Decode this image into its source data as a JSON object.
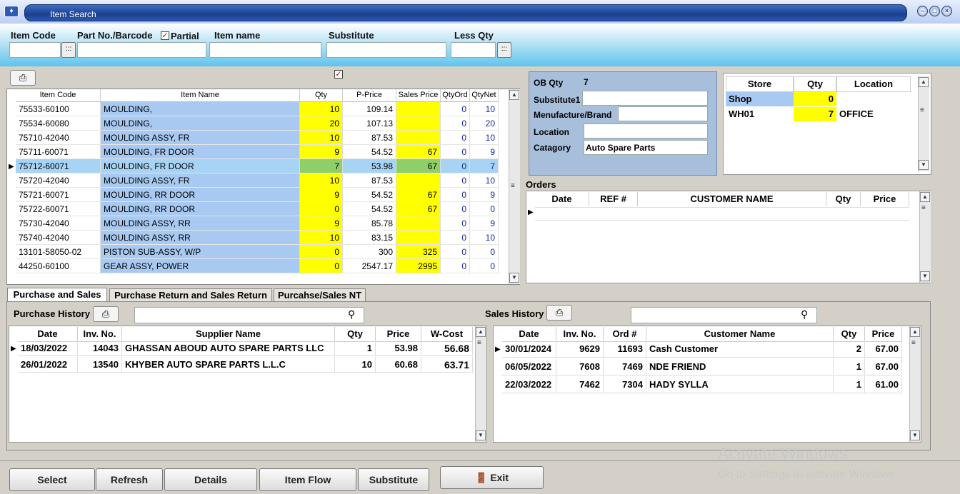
{
  "window": {
    "title": "Item Search"
  },
  "search": {
    "item_code_label": "Item Code",
    "partno_label": "Part No./Barcode",
    "partial_label": "Partial",
    "itemname_label": "Item name",
    "substitute_label": "Substitute",
    "lessqty_label": "Less Qty"
  },
  "items_grid": {
    "headers": [
      "Item Code",
      "Item Name",
      "Qty",
      "P-Price",
      "Sales Price",
      "QtyOrd",
      "QtyNet"
    ],
    "rows": [
      {
        "code": "75533-60100",
        "name": "MOULDING,",
        "qty": "10",
        "pprice": "109.14",
        "sprice": "",
        "ord": "0",
        "net": "10"
      },
      {
        "code": "75534-60080",
        "name": "MOULDING,",
        "qty": "20",
        "pprice": "107.13",
        "sprice": "",
        "ord": "0",
        "net": "20"
      },
      {
        "code": "75710-42040",
        "name": "MOULDING ASSY, FR",
        "qty": "10",
        "pprice": "87.53",
        "sprice": "",
        "ord": "0",
        "net": "10"
      },
      {
        "code": "75711-60071",
        "name": "MOULDING, FR DOOR",
        "qty": "9",
        "pprice": "54.52",
        "sprice": "67",
        "ord": "0",
        "net": "9"
      },
      {
        "code": "75712-60071",
        "name": "MOULDING, FR DOOR",
        "qty": "7",
        "pprice": "53.98",
        "sprice": "67",
        "ord": "0",
        "net": "7"
      },
      {
        "code": "75720-42040",
        "name": "MOULDING ASSY, FR",
        "qty": "10",
        "pprice": "87.53",
        "sprice": "",
        "ord": "0",
        "net": "10"
      },
      {
        "code": "75721-60071",
        "name": "MOULDING, RR DOOR",
        "qty": "9",
        "pprice": "54.52",
        "sprice": "67",
        "ord": "0",
        "net": "9"
      },
      {
        "code": "75722-60071",
        "name": "MOULDING, RR DOOR",
        "qty": "0",
        "pprice": "54.52",
        "sprice": "67",
        "ord": "0",
        "net": "0"
      },
      {
        "code": "75730-42040",
        "name": "MOULDING ASSY, RR",
        "qty": "9",
        "pprice": "85.78",
        "sprice": "",
        "ord": "0",
        "net": "9"
      },
      {
        "code": "75740-42040",
        "name": "MOULDING ASSY, RR",
        "qty": "10",
        "pprice": "83.15",
        "sprice": "",
        "ord": "0",
        "net": "10"
      },
      {
        "code": "13101-58050-02",
        "name": "PISTON SUB-ASSY, W/P",
        "qty": "0",
        "pprice": "300",
        "sprice": "325",
        "ord": "0",
        "net": "0"
      },
      {
        "code": "44250-60100",
        "name": "GEAR ASSY, POWER",
        "qty": "0",
        "pprice": "2547.17",
        "sprice": "2995",
        "ord": "0",
        "net": "0"
      }
    ]
  },
  "info": {
    "ob_qty_label": "OB Qty",
    "ob_qty": "7",
    "substitute1_label": "Substitute1",
    "manufacture_label": "Menufacture/Brand",
    "location_label": "Location",
    "category_label": "Catagory",
    "category_value": "Auto Spare Parts"
  },
  "stores": {
    "headers": [
      "Store",
      "Qty",
      "Location"
    ],
    "rows": [
      {
        "store": "Shop",
        "qty": "0",
        "location": ""
      },
      {
        "store": "WH01",
        "qty": "7",
        "location": "OFFICE"
      }
    ]
  },
  "orders": {
    "title": "Orders",
    "headers": [
      "Date",
      "REF #",
      "CUSTOMER NAME",
      "Qty",
      "Price"
    ]
  },
  "tabs": [
    "Purchase and Sales",
    "Purchase Return and Sales Return",
    "Purcahse/Sales NT"
  ],
  "purchase": {
    "title": "Purchase History",
    "headers": [
      "Date",
      "Inv. No.",
      "Supplier Name",
      "Qty",
      "Price",
      "W-Cost"
    ],
    "rows": [
      {
        "date": "18/03/2022",
        "inv": "14043",
        "name": "GHASSAN ABOUD AUTO SPARE PARTS LLC",
        "qty": "1",
        "price": "53.98",
        "wcost": "56.68"
      },
      {
        "date": "26/01/2022",
        "inv": "13540",
        "name": "KHYBER AUTO SPARE PARTS L.L.C",
        "qty": "10",
        "price": "60.68",
        "wcost": "63.71"
      }
    ]
  },
  "sales": {
    "title": "Sales History",
    "headers": [
      "Date",
      "Inv. No.",
      "Ord #",
      "Customer Name",
      "Qty",
      "Price"
    ],
    "rows": [
      {
        "date": "30/01/2024",
        "inv": "9629",
        "ord": "11693",
        "name": "Cash Customer",
        "qty": "2",
        "price": "67.00"
      },
      {
        "date": "06/05/2022",
        "inv": "7608",
        "ord": "7469",
        "name": "NDE FRIEND",
        "qty": "1",
        "price": "67.00"
      },
      {
        "date": "22/03/2022",
        "inv": "7462",
        "ord": "7304",
        "name": "HADY SYLLA",
        "qty": "1",
        "price": "61.00"
      }
    ]
  },
  "buttons": {
    "select": "Select",
    "refresh": "Refresh",
    "details": "Details",
    "item_flow": "Item Flow",
    "substitute": "Substitute",
    "exit": "Exit"
  },
  "watermark": {
    "line1": "Activate Windows",
    "line2": "Go to Settings to activate Windows."
  }
}
